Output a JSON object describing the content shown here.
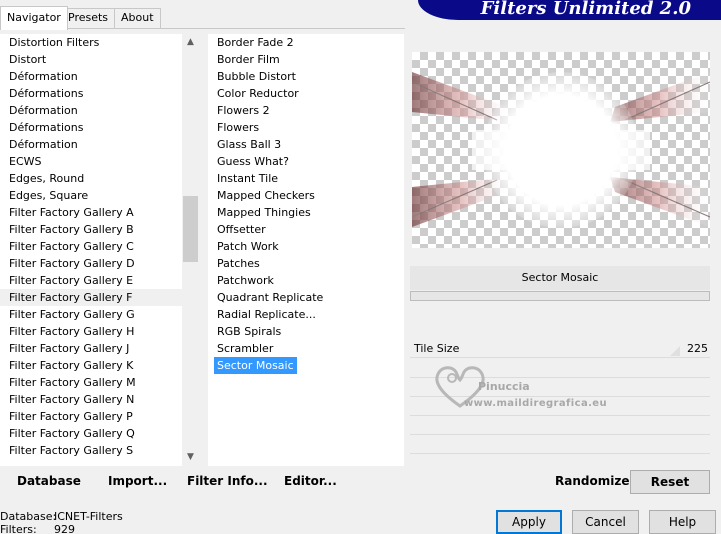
{
  "tabs": [
    "Navigator",
    "Presets",
    "About"
  ],
  "banner_title": "Filters Unlimited 2.0",
  "categories": [
    "Distortion Filters",
    "Distort",
    "Déformation",
    "Déformations",
    "Déformation",
    "Déformations",
    "Déformation",
    "ECWS",
    "Edges, Round",
    "Edges, Square",
    "Filter Factory Gallery A",
    "Filter Factory Gallery B",
    "Filter Factory Gallery C",
    "Filter Factory Gallery D",
    "Filter Factory Gallery E",
    "Filter Factory Gallery F",
    "Filter Factory Gallery G",
    "Filter Factory Gallery H",
    "Filter Factory Gallery J",
    "Filter Factory Gallery K",
    "Filter Factory Gallery M",
    "Filter Factory Gallery N",
    "Filter Factory Gallery P",
    "Filter Factory Gallery Q",
    "Filter Factory Gallery S"
  ],
  "selected_category": "Filter Factory Gallery F",
  "filters": [
    "Border Fade 2",
    "Border Film",
    "Bubble Distort",
    "Color Reductor",
    "Flowers 2",
    "Flowers",
    "Glass Ball 3",
    "Guess What?",
    "Instant Tile",
    "Mapped Checkers",
    "Mapped Thingies",
    "Offsetter",
    "Patch Work",
    "Patches",
    "Patchwork",
    "Quadrant Replicate",
    "Radial Replicate...",
    "RGB Spirals",
    "Scrambler",
    "Sector Mosaic"
  ],
  "selected_filter": "Sector Mosaic",
  "filter_name_display": "Sector Mosaic",
  "params": [
    {
      "label": "Tile Size",
      "value": "225"
    }
  ],
  "watermark": {
    "title": "Pinuccia",
    "url": "www.maildiregrafica.eu"
  },
  "bottom_left": {
    "database": "Database",
    "import": "Import...",
    "filter_info": "Filter Info...",
    "editor": "Editor..."
  },
  "bottom_right": {
    "randomize": "Randomize",
    "reset": "Reset"
  },
  "status": {
    "database_label": "Database:",
    "database_value": "ICNET-Filters",
    "filters_label": "Filters:",
    "filters_value": "929"
  },
  "buttons": {
    "apply": "Apply",
    "cancel": "Cancel",
    "help": "Help"
  },
  "colors": {
    "banner": "#0a0a88",
    "selection": "#3399ff",
    "default_button_border": "#0078d7"
  },
  "icons": {
    "scroll_up": "chevron-up-icon",
    "scroll_down": "chevron-down-icon",
    "watermark_logo": "heart-swirl-logo"
  }
}
